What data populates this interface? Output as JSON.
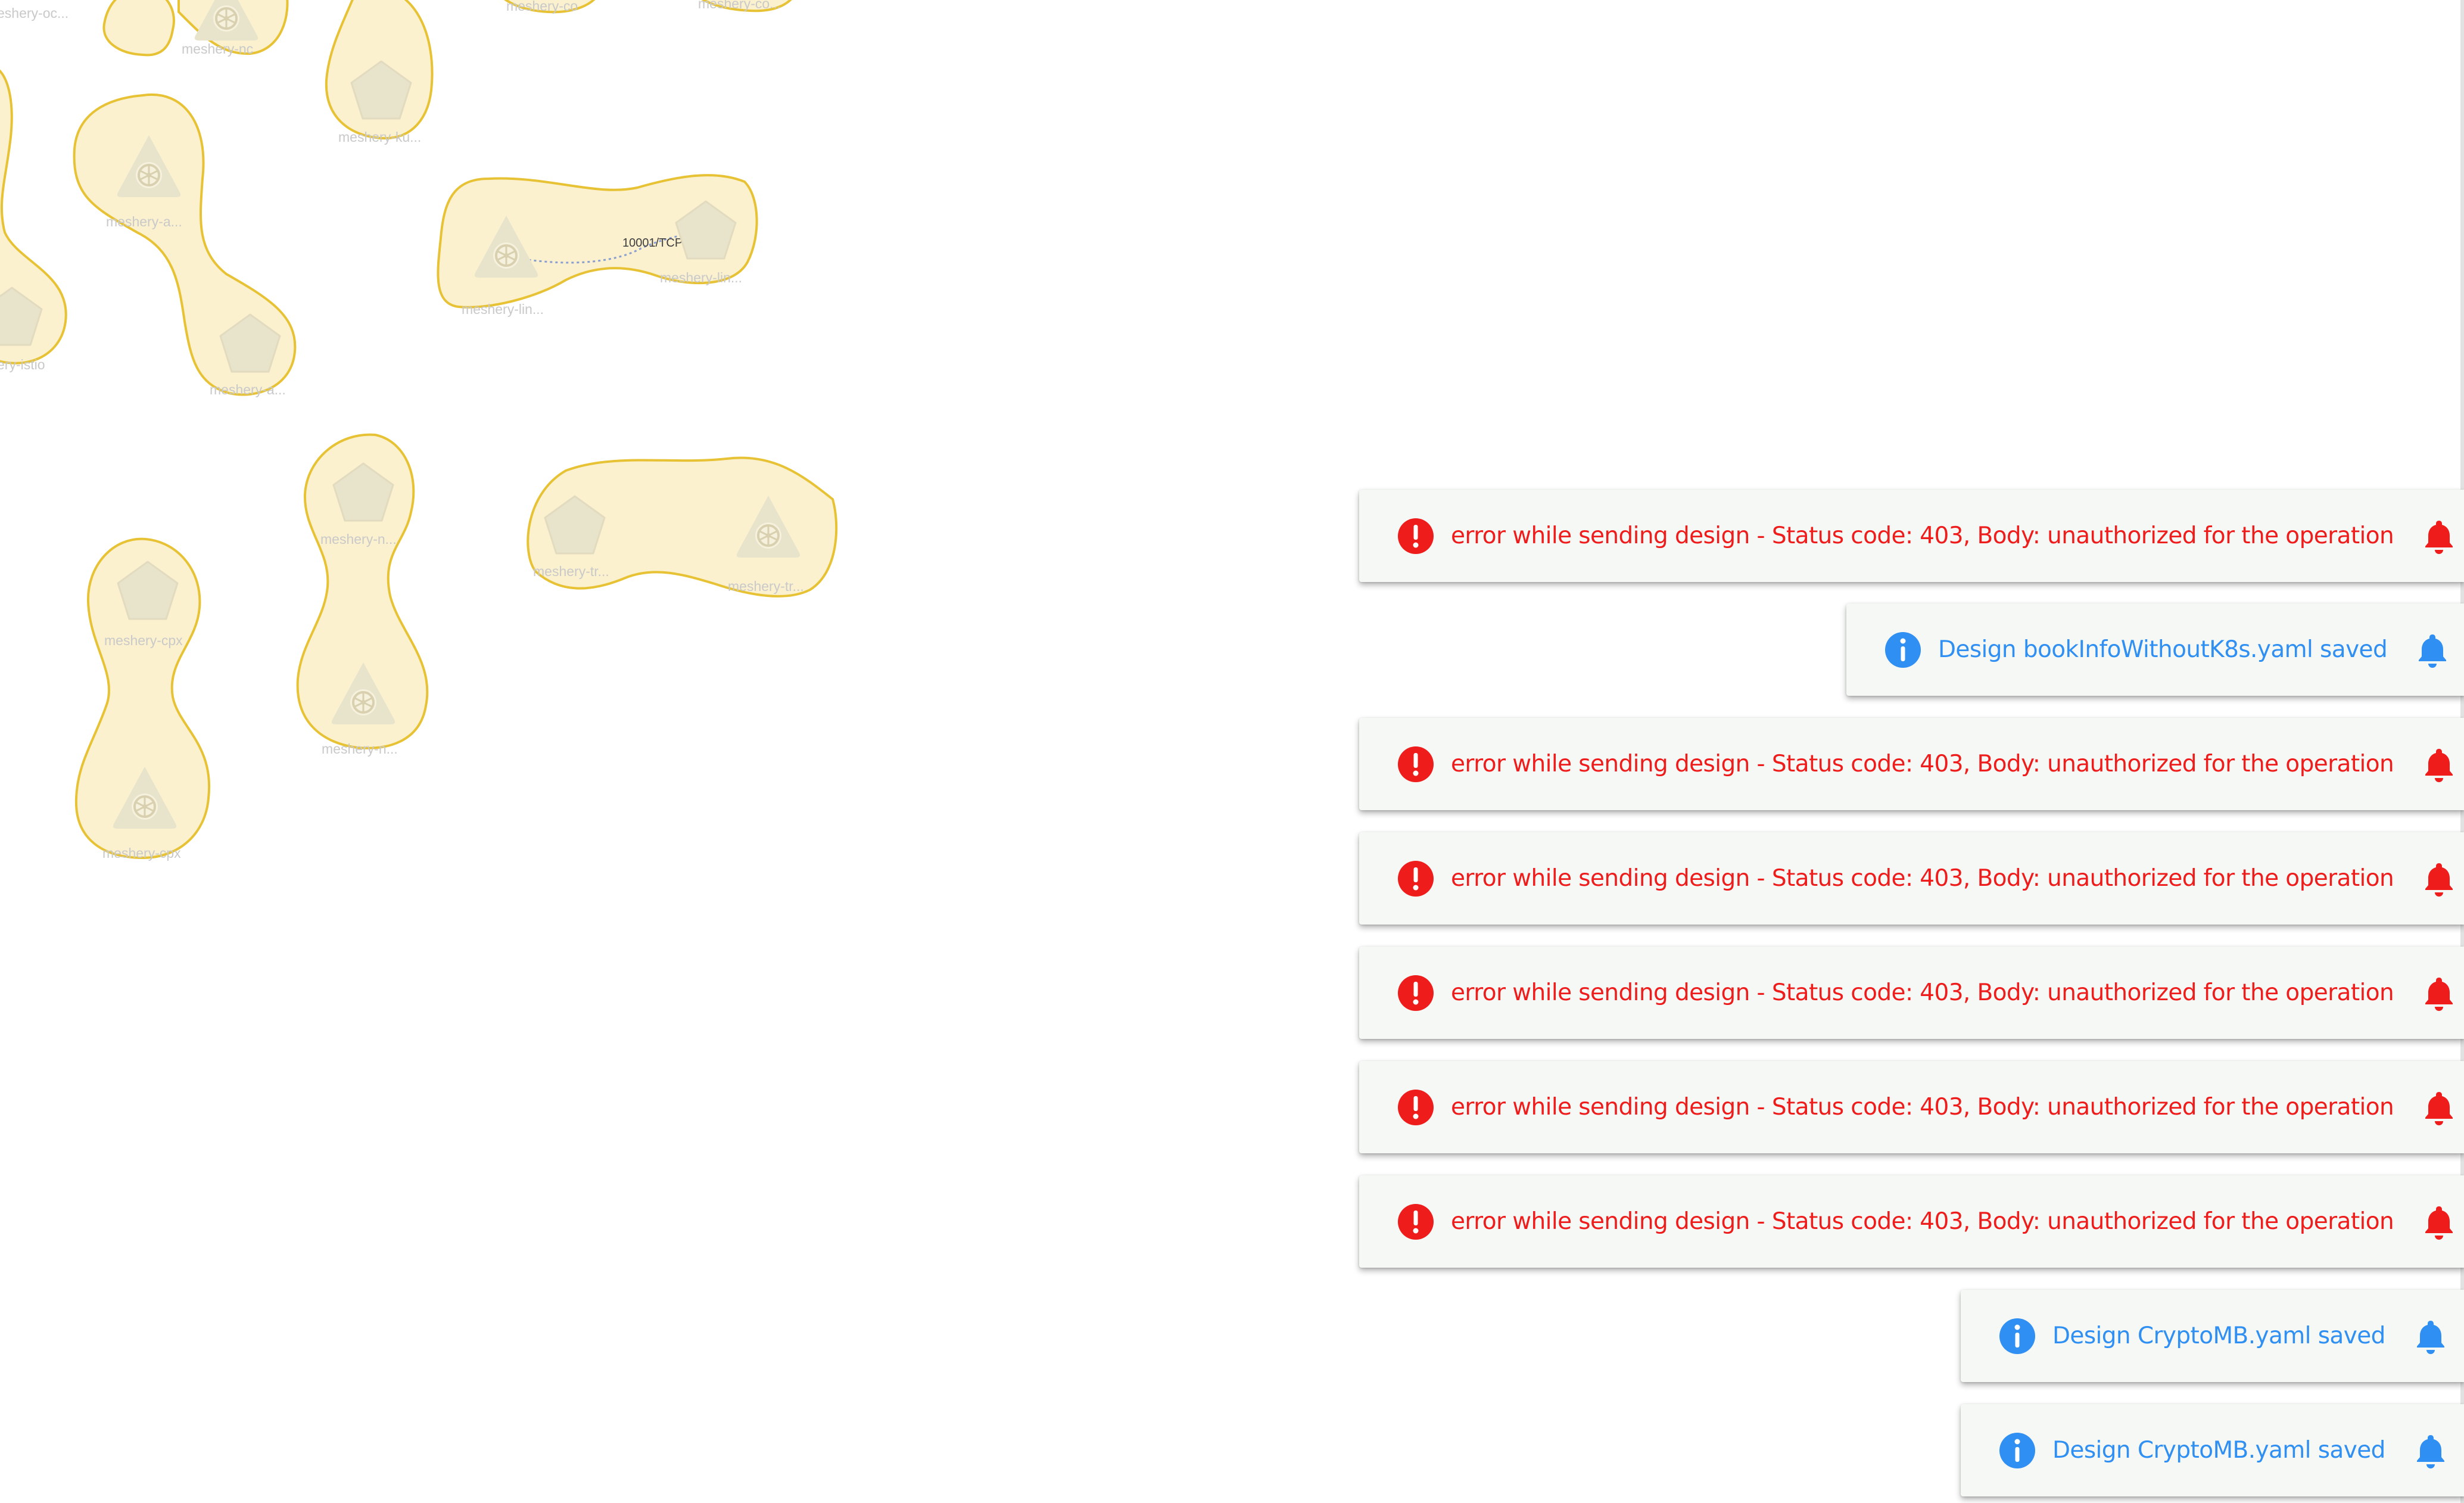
{
  "canvas": {
    "node_labels": [
      "eshery-oc...",
      "meshery-nc",
      "meshery-co",
      "meshery-co...",
      "meshery-ku...",
      "meshery-a...",
      "meshery-a...",
      "ery-istio",
      "meshery-lin...",
      "meshery-lin...",
      "meshery-n...",
      "meshery-n...",
      "meshery-tr...",
      "meshery-tr...",
      "meshery-cpx",
      "meshery-cpx"
    ],
    "edge_label": "10001/TCP",
    "colors": {
      "group_fill": "#fbf1cf",
      "group_stroke": "#e7c234",
      "node_fill": "#e8e3cb"
    }
  },
  "notifications": [
    {
      "type": "error",
      "text": "error while sending design - Status code: 403, Body: unauthorized for the operation",
      "icon": "error-circle-icon"
    },
    {
      "type": "info",
      "text": "Design bookInfoWithoutK8s.yaml saved",
      "icon": "info-circle-icon"
    },
    {
      "type": "error",
      "text": "error while sending design - Status code: 403, Body: unauthorized for the operation",
      "icon": "error-circle-icon"
    },
    {
      "type": "error",
      "text": "error while sending design - Status code: 403, Body: unauthorized for the operation",
      "icon": "error-circle-icon"
    },
    {
      "type": "error",
      "text": "error while sending design - Status code: 403, Body: unauthorized for the operation",
      "icon": "error-circle-icon"
    },
    {
      "type": "error",
      "text": "error while sending design - Status code: 403, Body: unauthorized for the operation",
      "icon": "error-circle-icon"
    },
    {
      "type": "error",
      "text": "error while sending design - Status code: 403, Body: unauthorized for the operation",
      "icon": "error-circle-icon"
    },
    {
      "type": "info",
      "text": "Design CryptoMB.yaml saved",
      "icon": "info-circle-icon"
    },
    {
      "type": "info",
      "text": "Design CryptoMB.yaml saved",
      "icon": "info-circle-icon"
    }
  ],
  "colors": {
    "error": "#ef1c1c",
    "info": "#2f8ff2",
    "toast_bg": "#f6f8f5"
  }
}
